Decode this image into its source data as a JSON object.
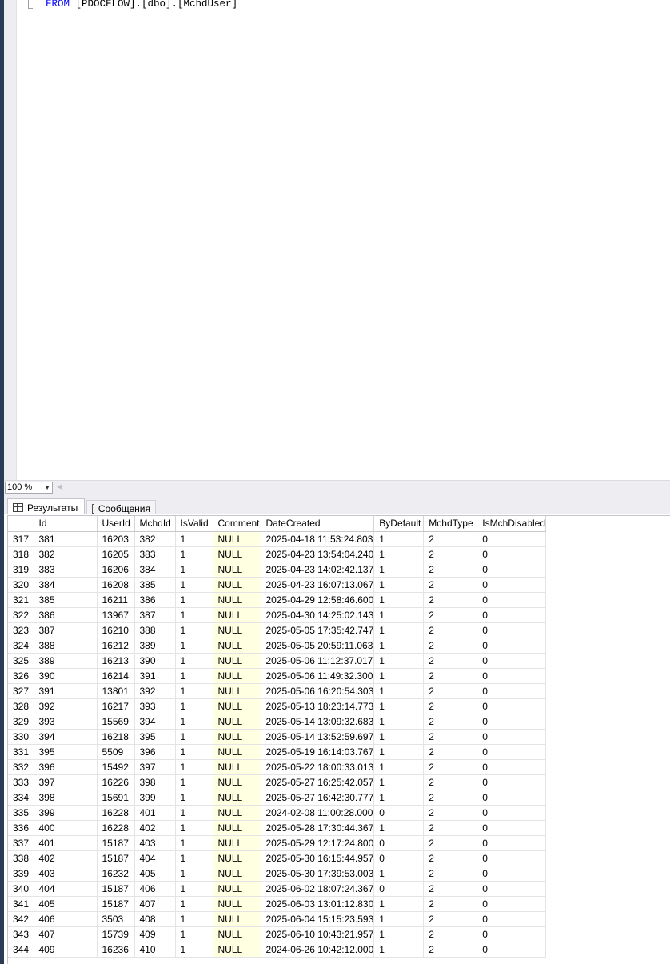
{
  "editor": {
    "code_keyword": "FROM",
    "code_table": "[PDOCFLOW].[dbo].[MchdUser]"
  },
  "zoom": {
    "value": "100 %"
  },
  "tabs": [
    {
      "label": "Результаты",
      "icon": "grid-icon",
      "active": true
    },
    {
      "label": "Сообщения",
      "icon": "messages-icon",
      "active": false
    }
  ],
  "results": {
    "columns": [
      "",
      "Id",
      "UserId",
      "MchdId",
      "IsValid",
      "Comment",
      "DateCreated",
      "ByDefault",
      "MchdType",
      "IsMchDisabled"
    ],
    "rows": [
      [
        "317",
        "381",
        "16203",
        "382",
        "1",
        "NULL",
        "2025-04-18 11:53:24.803",
        "1",
        "2",
        "0"
      ],
      [
        "318",
        "382",
        "16205",
        "383",
        "1",
        "NULL",
        "2025-04-23 13:54:04.240",
        "1",
        "2",
        "0"
      ],
      [
        "319",
        "383",
        "16206",
        "384",
        "1",
        "NULL",
        "2025-04-23 14:02:42.137",
        "1",
        "2",
        "0"
      ],
      [
        "320",
        "384",
        "16208",
        "385",
        "1",
        "NULL",
        "2025-04-23 16:07:13.067",
        "1",
        "2",
        "0"
      ],
      [
        "321",
        "385",
        "16211",
        "386",
        "1",
        "NULL",
        "2025-04-29 12:58:46.600",
        "1",
        "2",
        "0"
      ],
      [
        "322",
        "386",
        "13967",
        "387",
        "1",
        "NULL",
        "2025-04-30 14:25:02.143",
        "1",
        "2",
        "0"
      ],
      [
        "323",
        "387",
        "16210",
        "388",
        "1",
        "NULL",
        "2025-05-05 17:35:42.747",
        "1",
        "2",
        "0"
      ],
      [
        "324",
        "388",
        "16212",
        "389",
        "1",
        "NULL",
        "2025-05-05 20:59:11.063",
        "1",
        "2",
        "0"
      ],
      [
        "325",
        "389",
        "16213",
        "390",
        "1",
        "NULL",
        "2025-05-06 11:12:37.017",
        "1",
        "2",
        "0"
      ],
      [
        "326",
        "390",
        "16214",
        "391",
        "1",
        "NULL",
        "2025-05-06 11:49:32.300",
        "1",
        "2",
        "0"
      ],
      [
        "327",
        "391",
        "13801",
        "392",
        "1",
        "NULL",
        "2025-05-06 16:20:54.303",
        "1",
        "2",
        "0"
      ],
      [
        "328",
        "392",
        "16217",
        "393",
        "1",
        "NULL",
        "2025-05-13 18:23:14.773",
        "1",
        "2",
        "0"
      ],
      [
        "329",
        "393",
        "15569",
        "394",
        "1",
        "NULL",
        "2025-05-14 13:09:32.683",
        "1",
        "2",
        "0"
      ],
      [
        "330",
        "394",
        "16218",
        "395",
        "1",
        "NULL",
        "2025-05-14 13:52:59.697",
        "1",
        "2",
        "0"
      ],
      [
        "331",
        "395",
        "5509",
        "396",
        "1",
        "NULL",
        "2025-05-19 16:14:03.767",
        "1",
        "2",
        "0"
      ],
      [
        "332",
        "396",
        "15492",
        "397",
        "1",
        "NULL",
        "2025-05-22 18:00:33.013",
        "1",
        "2",
        "0"
      ],
      [
        "333",
        "397",
        "16226",
        "398",
        "1",
        "NULL",
        "2025-05-27 16:25:42.057",
        "1",
        "2",
        "0"
      ],
      [
        "334",
        "398",
        "15691",
        "399",
        "1",
        "NULL",
        "2025-05-27 16:42:30.777",
        "1",
        "2",
        "0"
      ],
      [
        "335",
        "399",
        "16228",
        "401",
        "1",
        "NULL",
        "2024-02-08 11:00:28.000",
        "0",
        "2",
        "0"
      ],
      [
        "336",
        "400",
        "16228",
        "402",
        "1",
        "NULL",
        "2025-05-28 17:30:44.367",
        "1",
        "2",
        "0"
      ],
      [
        "337",
        "401",
        "15187",
        "403",
        "1",
        "NULL",
        "2025-05-29 12:17:24.800",
        "0",
        "2",
        "0"
      ],
      [
        "338",
        "402",
        "15187",
        "404",
        "1",
        "NULL",
        "2025-05-30 16:15:44.957",
        "0",
        "2",
        "0"
      ],
      [
        "339",
        "403",
        "16232",
        "405",
        "1",
        "NULL",
        "2025-05-30 17:39:53.003",
        "1",
        "2",
        "0"
      ],
      [
        "340",
        "404",
        "15187",
        "406",
        "1",
        "NULL",
        "2025-06-02 18:07:24.367",
        "0",
        "2",
        "0"
      ],
      [
        "341",
        "405",
        "15187",
        "407",
        "1",
        "NULL",
        "2025-06-03 13:01:12.830",
        "1",
        "2",
        "0"
      ],
      [
        "342",
        "406",
        "3503",
        "408",
        "1",
        "NULL",
        "2025-06-04 15:15:23.593",
        "1",
        "2",
        "0"
      ],
      [
        "343",
        "407",
        "15739",
        "409",
        "1",
        "NULL",
        "2025-06-10 10:43:21.957",
        "1",
        "2",
        "0"
      ],
      [
        "344",
        "409",
        "16236",
        "410",
        "1",
        "NULL",
        "2024-06-26 10:42:12.000",
        "1",
        "2",
        "0"
      ]
    ]
  }
}
